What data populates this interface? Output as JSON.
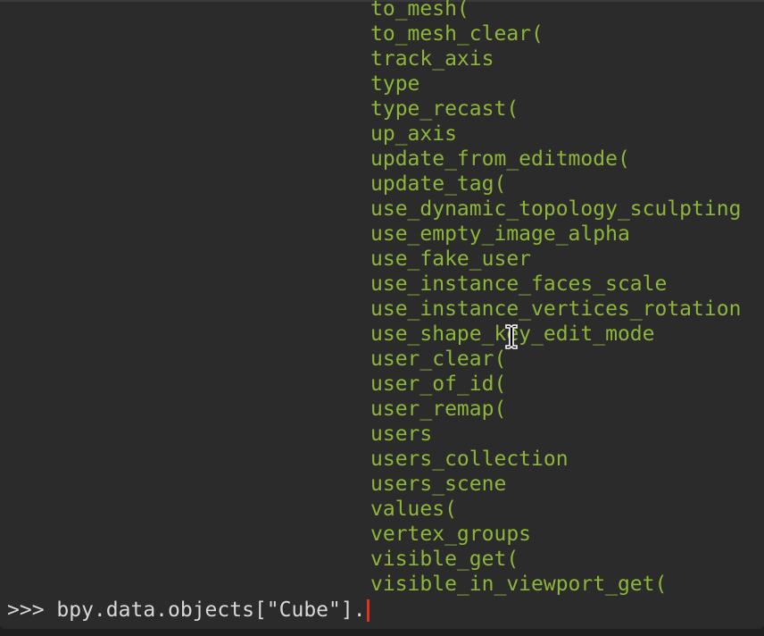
{
  "console": {
    "completions": [
      "to_mesh(",
      "to_mesh_clear(",
      "track_axis",
      "type",
      "type_recast(",
      "up_axis",
      "update_from_editmode(",
      "update_tag(",
      "use_dynamic_topology_sculpting",
      "use_empty_image_alpha",
      "use_fake_user",
      "use_instance_faces_scale",
      "use_instance_vertices_rotation",
      "use_shape_key_edit_mode",
      "user_clear(",
      "user_of_id(",
      "user_remap(",
      "users",
      "users_collection",
      "users_scene",
      "values(",
      "vertex_groups",
      "visible_get(",
      "visible_in_viewport_get("
    ],
    "prompt": ">>> ",
    "input": "bpy.data.objects[\"Cube\"].",
    "colors": {
      "background": "#2b2b2b",
      "completion_text": "#8db53a",
      "input_text": "#d8d8d8",
      "caret": "#e0321f"
    },
    "mouse_cursor": "text-ibeam-icon"
  }
}
